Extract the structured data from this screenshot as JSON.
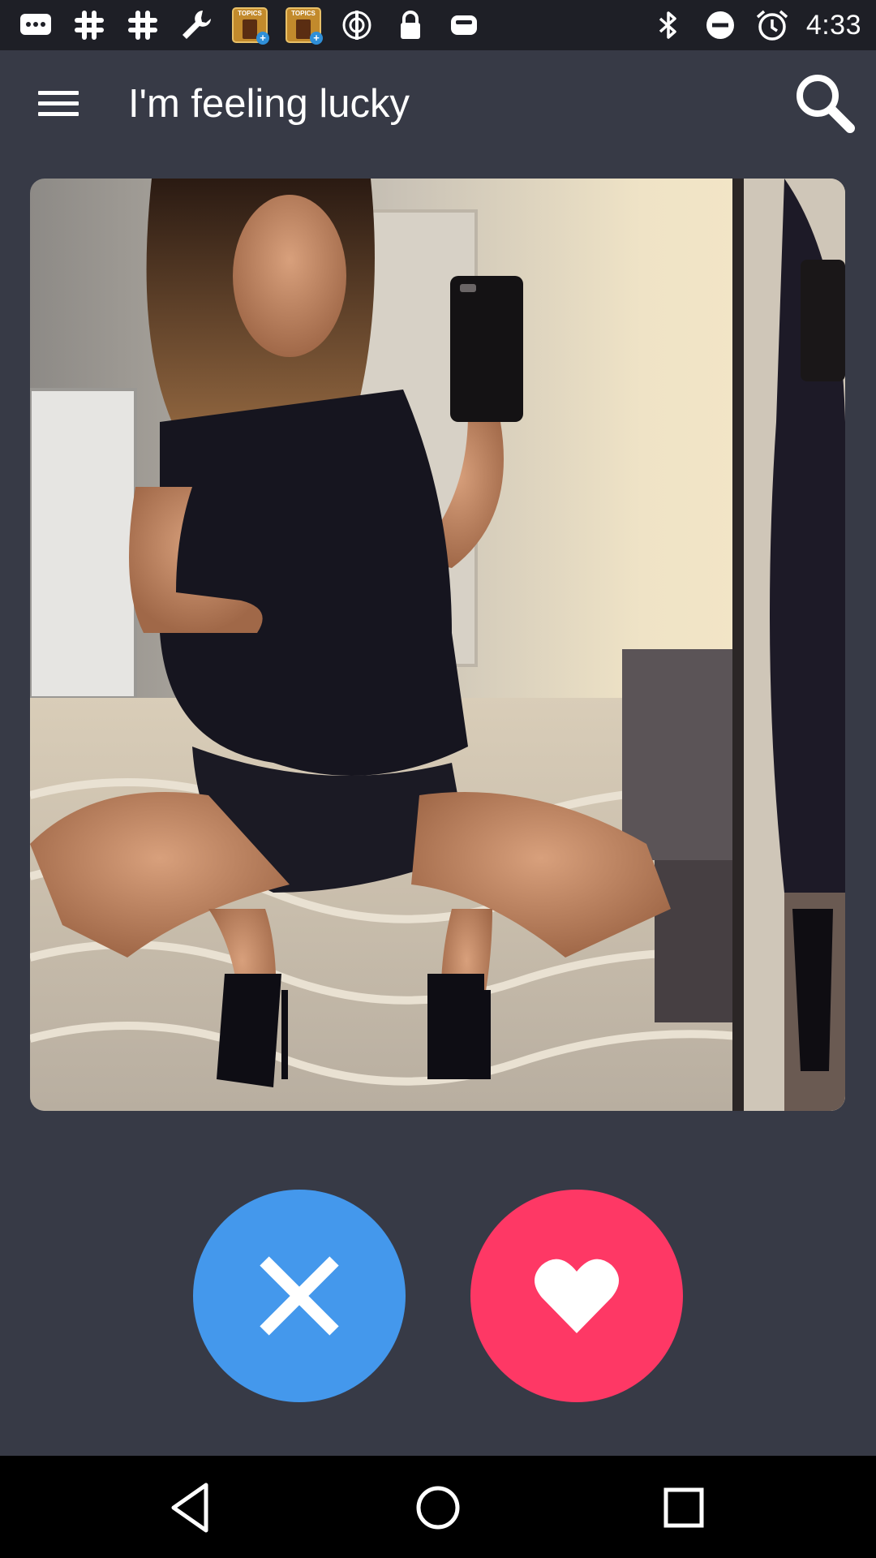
{
  "status_bar": {
    "time": "4:33",
    "topics_label": "TOPICS",
    "left_icons": [
      "messages-icon",
      "slack-icon",
      "slack-icon",
      "wrench-icon",
      "topics-app-icon",
      "topics-app-icon",
      "sync-icon",
      "lock-icon",
      "cloud-icon"
    ],
    "right_icons": [
      "bluetooth-icon",
      "do-not-disturb-icon",
      "alarm-icon"
    ]
  },
  "app_bar": {
    "title": "I'm feeling lucky",
    "menu_icon": "hamburger-menu-icon",
    "search_icon": "search-icon"
  },
  "card": {
    "image_subject": "profile-photo"
  },
  "actions": {
    "dislike_icon": "close-x-icon",
    "like_icon": "heart-icon",
    "dislike_color": "#4498ec",
    "like_color": "#fe3865"
  },
  "nav_bar": {
    "back_icon": "back-triangle-icon",
    "home_icon": "home-circle-icon",
    "recents_icon": "recents-square-icon"
  },
  "theme": {
    "background": "#373a46",
    "status_bar": "#1e1f26",
    "text": "#ffffff"
  }
}
